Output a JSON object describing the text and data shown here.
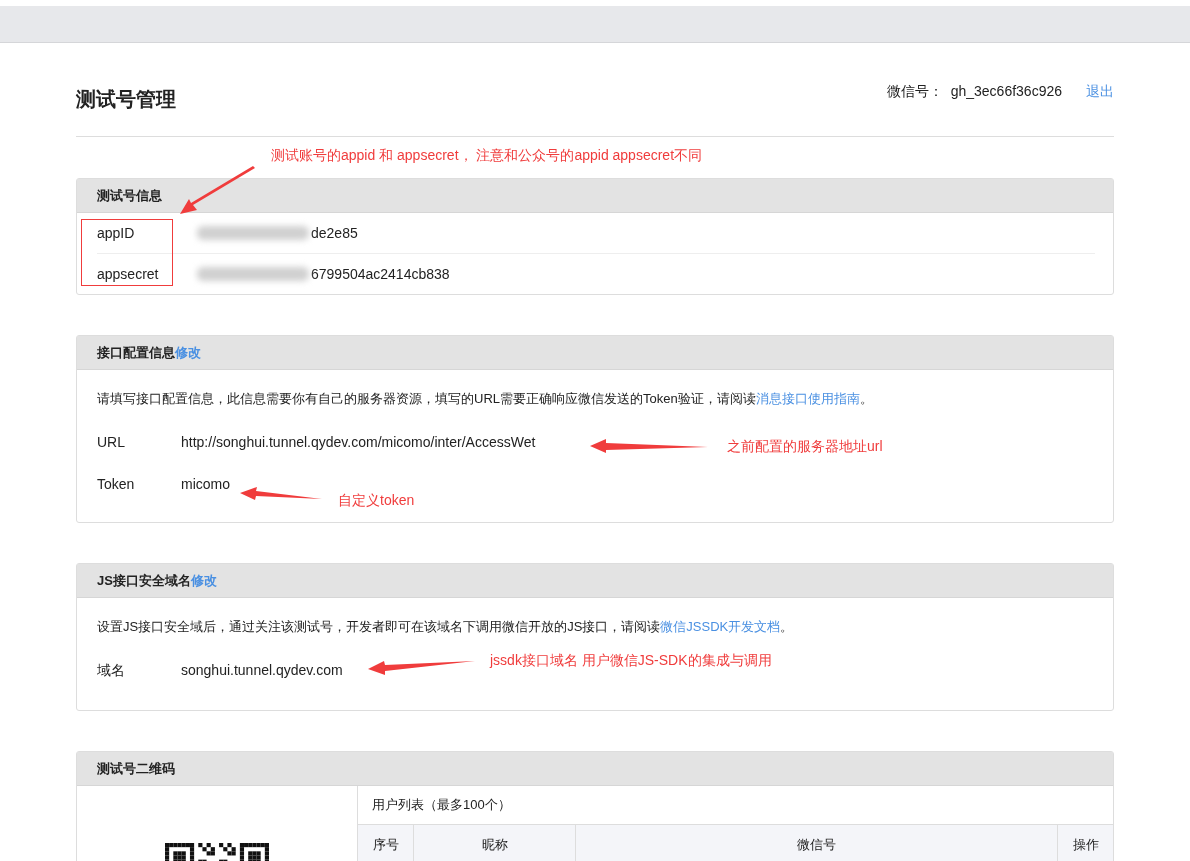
{
  "header": {
    "title": "测试号管理",
    "account_label": "微信号：",
    "account": "gh_3ec66f36c926",
    "logout": "退出"
  },
  "sections": [
    {
      "kind": "info",
      "title": "测试号信息",
      "rows": [
        {
          "label": "appID",
          "value": "de2e85",
          "redacted": true
        },
        {
          "label": "appsecret",
          "value": "6799504ac2414cb838",
          "redacted": true
        }
      ]
    },
    {
      "kind": "config",
      "title": "接口配置信息",
      "edit": "修改",
      "description": "请填写接口配置信息，此信息需要你有自己的服务器资源，填写的URL需要正确响应微信发送的Token验证，请阅读",
      "link": "消息接口使用指南",
      "tail": "。",
      "rows": [
        {
          "label": "URL",
          "value": "http://songhui.tunnel.qydev.com/micomo/inter/AccessWet"
        },
        {
          "label": "Token",
          "value": "micomo"
        }
      ]
    },
    {
      "kind": "config",
      "title": "JS接口安全域名",
      "edit": "修改",
      "description": "设置JS接口安全域后，通过关注该测试号，开发者即可在该域名下调用微信开放的JS接口，请阅读",
      "link": "微信JSSDK开发文档",
      "tail": "。",
      "rows": [
        {
          "label": "域名",
          "value": "songhui.tunnel.qydev.com"
        }
      ]
    },
    {
      "kind": "qrcode",
      "title": "测试号二维码",
      "caption": "用户列表（最多100个）",
      "columns": [
        "序号",
        "昵称",
        "微信号",
        "操作"
      ]
    }
  ],
  "annotations": [
    {
      "text": "测试账号的appid 和 appsecret， 注意和公众号的appid appsecret不同"
    },
    {
      "text": "之前配置的服务器地址url"
    },
    {
      "text": "自定义token"
    },
    {
      "text": "jssdk接口域名 用户微信JS-SDK的集成与调用"
    }
  ]
}
